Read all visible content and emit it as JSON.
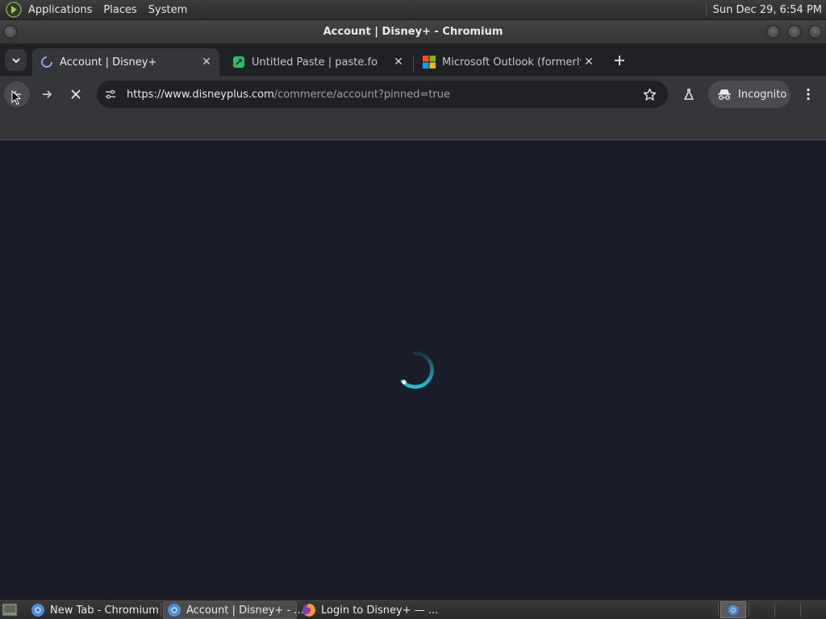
{
  "top_panel": {
    "menus": [
      "Applications",
      "Places",
      "System"
    ],
    "clock": "Sun Dec 29,  6:54 PM"
  },
  "window": {
    "title": "Account | Disney+ - Chromium"
  },
  "tabs": [
    {
      "title": "Account | Disney+",
      "active": true,
      "favicon": "loading-spinner-icon"
    },
    {
      "title": "Untitled Paste | paste.fo",
      "active": false,
      "favicon": "paste-fo-icon"
    },
    {
      "title": "Microsoft Outlook (formerly",
      "active": false,
      "favicon": "microsoft-icon"
    }
  ],
  "toolbar": {
    "url_host": "https://www.disneyplus.com",
    "url_path": "/commerce/account?pinned=true",
    "incognito_label": "Incognito"
  },
  "taskbar": {
    "tasks": [
      {
        "label": "New Tab - Chromium",
        "icon": "chromium-icon",
        "active": false
      },
      {
        "label": "Account | Disney+ - ...",
        "icon": "chromium-icon",
        "active": true
      },
      {
        "label": "Login to Disney+ — ...",
        "icon": "firefox-icon",
        "active": false
      }
    ]
  },
  "colors": {
    "content_bg": "#1a1d29",
    "spinner": "#1bc4d6",
    "tab_strip": "#202124",
    "toolbar": "#35363a"
  }
}
